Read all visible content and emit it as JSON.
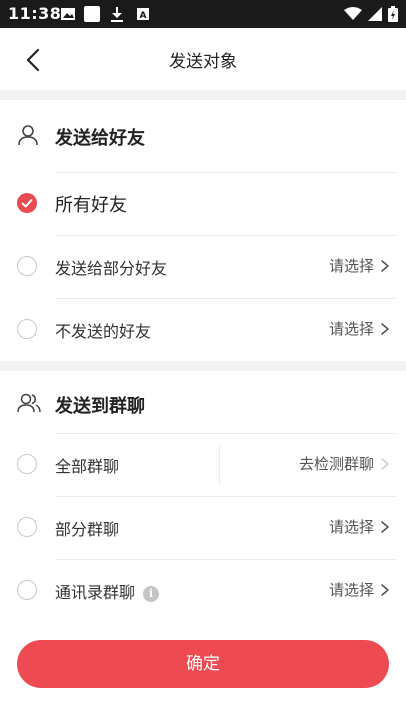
{
  "status_bar": {
    "time": "11:38"
  },
  "header": {
    "title": "发送对象"
  },
  "friends_section": {
    "title": "发送给好友",
    "options": [
      {
        "label": "所有好友",
        "checked": true,
        "action": ""
      },
      {
        "label": "发送给部分好友",
        "checked": false,
        "action": "请选择"
      },
      {
        "label": "不发送的好友",
        "checked": false,
        "action": "请选择"
      }
    ]
  },
  "groups_section": {
    "title": "发送到群聊",
    "options": [
      {
        "label": "全部群聊",
        "checked": false,
        "action": "去检测群聊"
      },
      {
        "label": "部分群聊",
        "checked": false,
        "action": "请选择"
      },
      {
        "label": "通讯录群聊",
        "checked": false,
        "action": "请选择",
        "info_glyph": "i"
      }
    ]
  },
  "confirm_button": {
    "label": "确定"
  },
  "colors": {
    "accent": "#ee4a52",
    "divider": "#ececec",
    "section_gap": "#f2f2f2"
  }
}
